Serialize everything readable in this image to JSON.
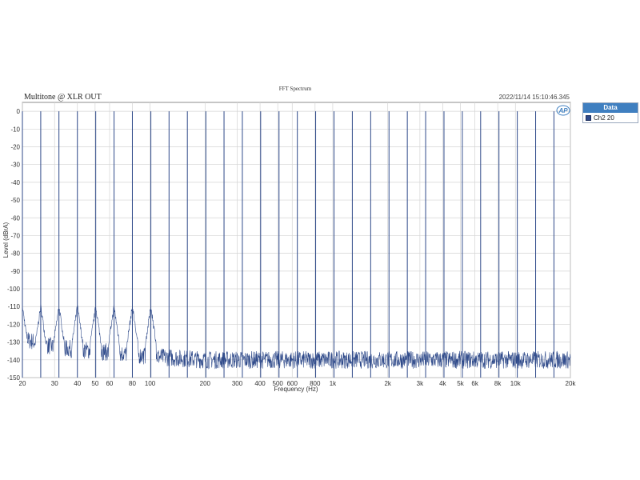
{
  "chart_data": {
    "type": "line",
    "title": "FFT Spectrum",
    "subtitle": "Multitone @ XLR OUT",
    "timestamp": "2022/11/14 15:10:46.345",
    "logo": "AP",
    "xlabel": "Frequency (Hz)",
    "ylabel": "Level (dBrA)",
    "xscale": "log",
    "xlim": [
      20,
      20000
    ],
    "ylim": [
      -150,
      5
    ],
    "grid": true,
    "legend_position": "right",
    "legend_title": "Data",
    "x_ticks": [
      {
        "value": 20,
        "label": "20"
      },
      {
        "value": 30,
        "label": "30"
      },
      {
        "value": 40,
        "label": "40"
      },
      {
        "value": 50,
        "label": "50"
      },
      {
        "value": 60,
        "label": "60"
      },
      {
        "value": 80,
        "label": "80"
      },
      {
        "value": 100,
        "label": "100"
      },
      {
        "value": 200,
        "label": "200"
      },
      {
        "value": 300,
        "label": "300"
      },
      {
        "value": 400,
        "label": "400"
      },
      {
        "value": 500,
        "label": "500"
      },
      {
        "value": 600,
        "label": "600"
      },
      {
        "value": 800,
        "label": "800"
      },
      {
        "value": 1000,
        "label": "1k"
      },
      {
        "value": 2000,
        "label": "2k"
      },
      {
        "value": 3000,
        "label": "3k"
      },
      {
        "value": 4000,
        "label": "4k"
      },
      {
        "value": 5000,
        "label": "5k"
      },
      {
        "value": 6000,
        "label": "6k"
      },
      {
        "value": 8000,
        "label": "8k"
      },
      {
        "value": 10000,
        "label": "10k"
      },
      {
        "value": 20000,
        "label": "20k"
      }
    ],
    "y_ticks": [
      0,
      -10,
      -20,
      -30,
      -40,
      -50,
      -60,
      -70,
      -80,
      -90,
      -100,
      -110,
      -120,
      -130,
      -140,
      -150
    ],
    "series": [
      {
        "name": "Ch2 20",
        "color": "#2f4a8a",
        "tones_hz": [
          20,
          25.2,
          31.7,
          40,
          50.4,
          63.5,
          80,
          101,
          127,
          160,
          202,
          254,
          320,
          403,
          508,
          640,
          806,
          1016,
          1280,
          1613,
          2032,
          2560,
          3225,
          4064,
          5120,
          6451,
          8127,
          10240,
          12902,
          16255
        ],
        "tone_level_db": 0,
        "noise_floor_db": [
          {
            "hz": 20,
            "db": -128
          },
          {
            "hz": 30,
            "db": -133
          },
          {
            "hz": 50,
            "db": -135
          },
          {
            "hz": 100,
            "db": -138
          },
          {
            "hz": 200,
            "db": -140
          },
          {
            "hz": 1000,
            "db": -140
          },
          {
            "hz": 20000,
            "db": -140
          }
        ]
      }
    ]
  }
}
